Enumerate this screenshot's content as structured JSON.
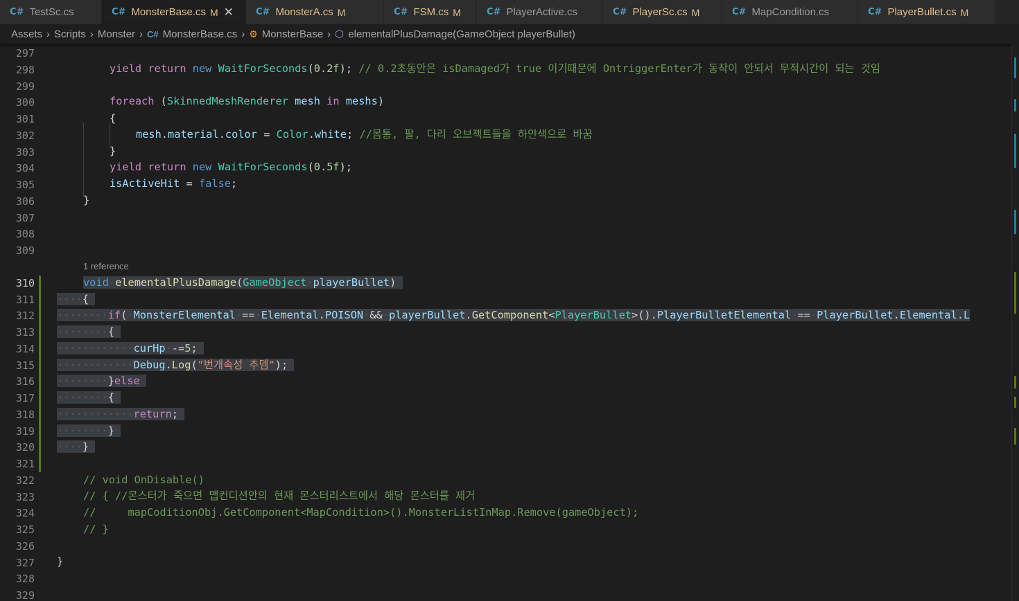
{
  "tabs": [
    {
      "name": "TestSc.cs",
      "modified": "",
      "active": false
    },
    {
      "name": "MonsterBase.cs",
      "modified": "M",
      "active": true
    },
    {
      "name": "MonsterA.cs",
      "modified": "M",
      "active": false
    },
    {
      "name": "FSM.cs",
      "modified": "M",
      "active": false
    },
    {
      "name": "PlayerActive.cs",
      "modified": "",
      "active": false
    },
    {
      "name": "PlayerSc.cs",
      "modified": "M",
      "active": false
    },
    {
      "name": "MapCondition.cs",
      "modified": "",
      "active": false
    },
    {
      "name": "PlayerBullet.cs",
      "modified": "M",
      "active": false
    }
  ],
  "breadcrumb": {
    "assets": "Assets",
    "scripts": "Scripts",
    "monster": "Monster",
    "file": "MonsterBase.cs",
    "class": "MonsterBase",
    "method": "elementalPlusDamage(GameObject playerBullet)"
  },
  "codelens": "1 reference",
  "current_line": 310,
  "line_numbers": [
    297,
    298,
    299,
    300,
    301,
    302,
    303,
    304,
    305,
    306,
    307,
    308,
    309,
    310,
    311,
    312,
    313,
    314,
    315,
    316,
    317,
    318,
    319,
    320,
    321,
    322,
    323,
    324,
    325,
    326,
    327,
    328,
    329
  ],
  "code": {
    "l298": {
      "yield": "yield",
      "ret": "return",
      "nw": "new",
      "ty": "WaitForSeconds",
      "num": "0.2f",
      "cmt": "// 0.2초동안은 isDamaged가 true 이기때문에 OntriggerEnter가 동작이 안되서 무적시간이 되는 것임"
    },
    "l300": {
      "foreach": "foreach",
      "ty": "SkinnedMeshRenderer",
      "v1": "mesh",
      "in": "in",
      "v2": "meshs"
    },
    "l302": {
      "v": "mesh.material.color",
      "ty": "Color",
      "v2": "white",
      "cmt": "//몸통, 팔, 다리 오브젝트들을 하얀색으로 바꿈"
    },
    "l304": {
      "yield": "yield",
      "ret": "return",
      "nw": "new",
      "ty": "WaitForSeconds",
      "num": "0.5f"
    },
    "l305": {
      "v": "isActiveHit",
      "kw": "false"
    },
    "l310": {
      "kw": "void",
      "fn": "elementalPlusDamage",
      "ty": "GameObject",
      "v": "playerBullet"
    },
    "l312": {
      "ifkw": "if",
      "v1": "MonsterElemental",
      "v2": "Elemental",
      "v3": "POISON",
      "v4": "playerBullet",
      "fn": "GetComponent",
      "ty": "PlayerBullet",
      "v5": "PlayerBulletElemental",
      "v6": "PlayerBullet",
      "v7": "Elemental",
      "v8": "L"
    },
    "l314": {
      "v": "curHp",
      "num": "5"
    },
    "l315": {
      "v": "Debug",
      "fn": "Log",
      "str": "\"번개속성 추뎀\""
    },
    "l316": {
      "kw": "else"
    },
    "l318": {
      "kw": "return"
    },
    "l322": {
      "cmt": "// void OnDisable()"
    },
    "l323": {
      "cmt": "// { //몬스터가 죽으면 맵컨디션안의 현재 몬스터리스트에서 해당 몬스터를 제거"
    },
    "l324": {
      "cmt": "//     mapCoditionObj.GetComponent<MapCondition>().MonsterListInMap.Remove(gameObject);"
    },
    "l325": {
      "cmt": "// }"
    }
  },
  "colors": {
    "background": "#1e1e1e",
    "keyword": "#569cd6",
    "control": "#c586c0",
    "type": "#4ec9b0",
    "function": "#dcdcaa",
    "variable": "#9cdcfe",
    "number": "#b5cea8",
    "string": "#ce9178",
    "comment": "#6a9955",
    "selection": "#3a3d41"
  }
}
